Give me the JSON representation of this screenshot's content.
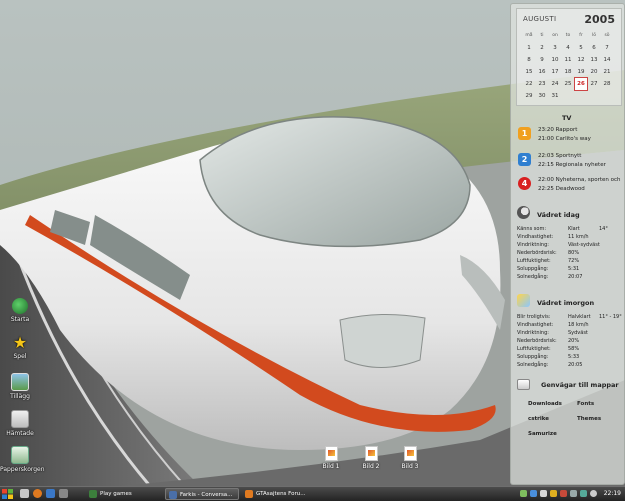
{
  "desktop_icons": [
    {
      "label": "Starta",
      "icon": "globe-icon"
    },
    {
      "label": "Spel",
      "icon": "star-icon"
    },
    {
      "label": "Tillägg",
      "icon": "picture-icon"
    },
    {
      "label": "Hämtade",
      "icon": "folder-icon"
    },
    {
      "label": "Papperskorgen",
      "icon": "recycle-bin-icon"
    }
  ],
  "files": [
    {
      "label": "Bild 1"
    },
    {
      "label": "Bild 2"
    },
    {
      "label": "Bild 3"
    }
  ],
  "calendar": {
    "month": "AUGUSTI",
    "year": "2005",
    "day_headers": [
      "må",
      "ti",
      "on",
      "to",
      "fr",
      "lö",
      "sö"
    ],
    "today": "26",
    "rows": [
      [
        "1",
        "2",
        "3",
        "4",
        "5",
        "6",
        "7"
      ],
      [
        "8",
        "9",
        "10",
        "11",
        "12",
        "13",
        "14"
      ],
      [
        "15",
        "16",
        "17",
        "18",
        "19",
        "20",
        "21"
      ],
      [
        "22",
        "23",
        "24",
        "25",
        "26",
        "27",
        "28"
      ],
      [
        "29",
        "30",
        "31",
        "",
        "",
        "",
        ""
      ]
    ]
  },
  "tv": {
    "title": "TV",
    "channels": [
      {
        "logo": "1",
        "color": "#f0a020",
        "lines": [
          "23:20 Rapport",
          "21:00 Carlito's way"
        ]
      },
      {
        "logo": "2",
        "color": "#2f7fd0",
        "lines": [
          "22:03 Sportnytt",
          "22:15 Regionala nyheter"
        ]
      },
      {
        "logo": "4",
        "color": "#d82020",
        "lines": [
          "22:00 Nyheterna, sporten och",
          "22:25 Deadwood"
        ]
      }
    ]
  },
  "weather_today": {
    "title": "Vädret idag",
    "rows": [
      {
        "k": "Känns som:",
        "v": "Klart",
        "v2": "14°"
      },
      {
        "k": "Vindhastighet:",
        "v": "11 km/h",
        "v2": ""
      },
      {
        "k": "Vindriktning:",
        "v": "Väst-sydväst",
        "v2": ""
      },
      {
        "k": "Nederbördsrisk:",
        "v": "80%",
        "v2": ""
      },
      {
        "k": "Luftfuktighet:",
        "v": "72%",
        "v2": ""
      },
      {
        "k": "Soluppgång:",
        "v": "5:31",
        "v2": ""
      },
      {
        "k": "Solnedgång:",
        "v": "20:07",
        "v2": ""
      }
    ]
  },
  "weather_tomorrow": {
    "title": "Vädret imorgon",
    "rows": [
      {
        "k": "Blir troligtvis:",
        "v": "Halvklart",
        "v2": "11° - 19°"
      },
      {
        "k": "Vindhastighet:",
        "v": "18 km/h",
        "v2": ""
      },
      {
        "k": "Vindriktning:",
        "v": "Sydväst",
        "v2": ""
      },
      {
        "k": "Nederbördsrisk:",
        "v": "20%",
        "v2": ""
      },
      {
        "k": "Luftfuktighet:",
        "v": "58%",
        "v2": ""
      },
      {
        "k": "Soluppgång:",
        "v": "5:33",
        "v2": ""
      },
      {
        "k": "Solnedgång:",
        "v": "20:05",
        "v2": ""
      }
    ]
  },
  "shortcuts": {
    "title": "Genvägar till mappar",
    "items": [
      "Downloads",
      "Fonts",
      "cstrike",
      "Themes",
      "Samurize"
    ]
  },
  "taskbar": {
    "tasks": [
      {
        "label": "Play games",
        "color": "#3c7f3c"
      },
      {
        "label": "Farkis - Conversa...",
        "color": "#4a6fa8"
      },
      {
        "label": "GTAsajtens Foru...",
        "color": "#e07a20"
      }
    ],
    "clock": "22:19"
  }
}
